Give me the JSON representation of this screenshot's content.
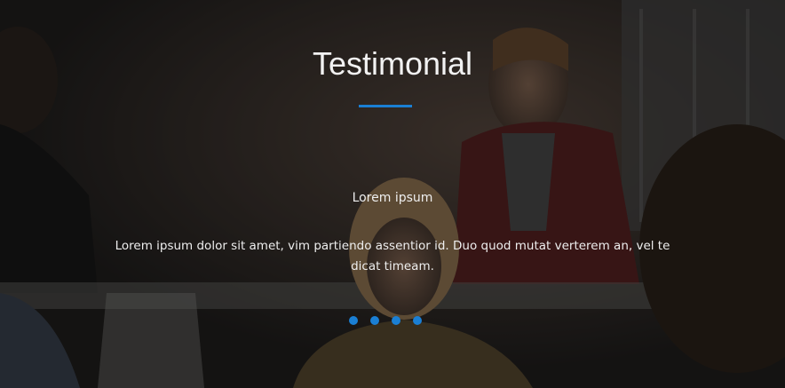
{
  "testimonial": {
    "title": "Testimonial",
    "name": "Lorem ipsum",
    "quote": "Lorem ipsum dolor sit amet, vim partiendo assentior id. Duo quod mutat verterem an, vel te dicat timeam."
  },
  "carousel": {
    "slide_count": 4,
    "active_index": 0
  },
  "colors": {
    "accent": "#1a7fd4"
  }
}
